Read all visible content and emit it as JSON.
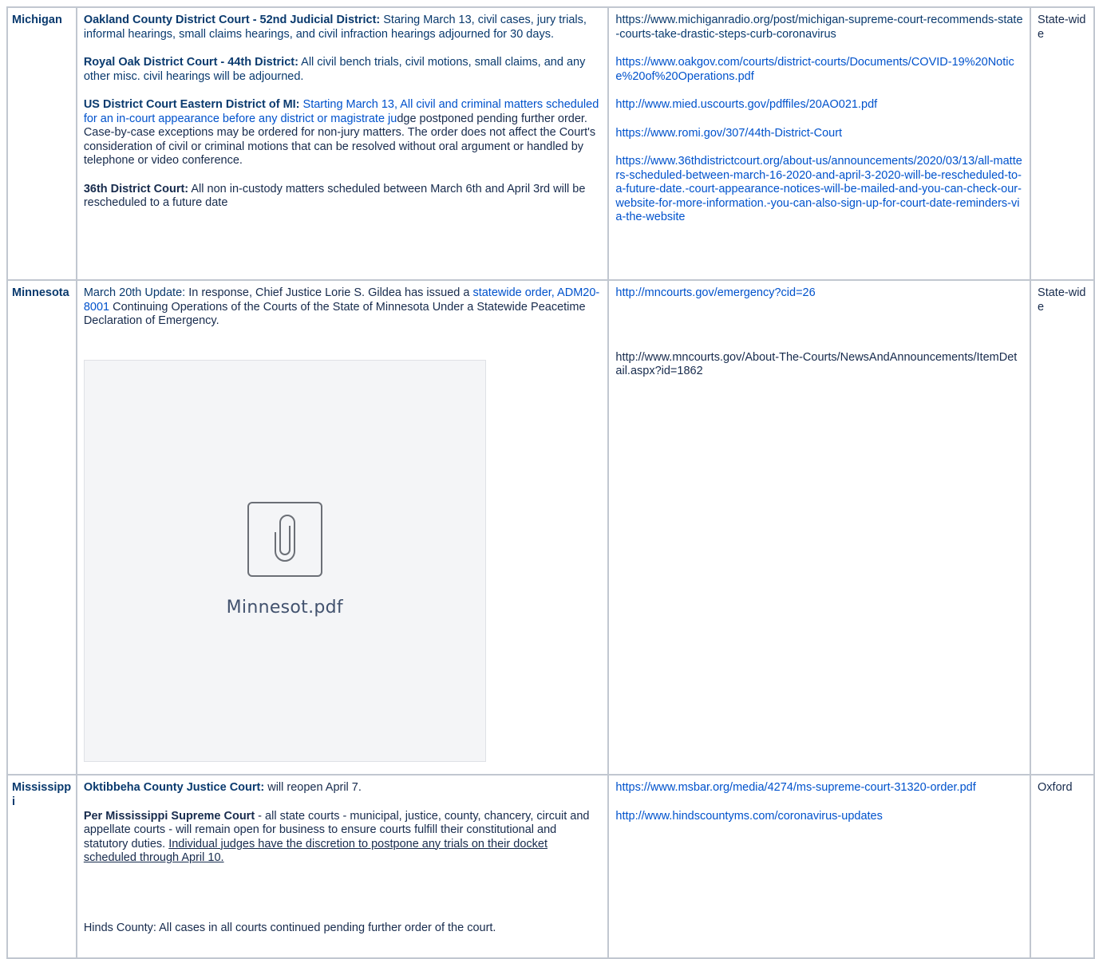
{
  "rows": [
    {
      "state": "Michigan",
      "scope": "State-wide",
      "paragraphs": [
        {
          "bold": "Oakland County District Court - 52nd Judicial District:",
          "text": " Staring March 13, civil cases, jury trials, informal hearings, small claims hearings, and civil infraction hearings adjourned for 30 days."
        },
        {
          "bold": "Royal Oak District Court - 44th District:",
          "text": " All civil bench trials, civil motions, small claims, and any other misc. civil hearings will be adjourned."
        },
        {
          "bold": "US District Court Eastern District of MI:",
          "text_link": "  Starting March 13, All civil and criminal matters scheduled for an in-court appearance before any district or magistrate ju",
          "text": "dge postponed pending further order.  Case-by-case exceptions may be ordered for non-jury matters.  The order does not affect the Court's consideration of civil or criminal motions that can be resolved without oral argument or handled by telephone or video conference."
        },
        {
          "bold": "36th District Court:",
          "text": " All non in-custody matters scheduled between March 6th and April 3rd will be rescheduled to a future date"
        }
      ],
      "links": [
        "https://www.michiganradio.org/post/michigan-supreme-court-recommends-state-courts-take-drastic-steps-curb-coronavirus",
        "https://www.oakgov.com/courts/district-courts/Documents/COVID-19%20Notice%20of%20Operations.pdf",
        "http://www.mied.uscourts.gov/pdffiles/20AO021.pdf",
        "https://www.romi.gov/307/44th-District-Court",
        "https://www.36thdistrictcourt.org/about-us/announcements/2020/03/13/all-matters-scheduled-between-march-16-2020-and-april-3-2020-will-be-rescheduled-to-a-future-date.-court-appearance-notices-will-be-mailed-and-you-can-check-our-website-for-more-information.-you-can-also-sign-up-for-court-date-reminders-via-the-website"
      ]
    },
    {
      "state": "Minnesota",
      "scope": "State-wide",
      "update_lead": "March 20th Update:",
      "update_text_1": "  In response, Chief Justice Lorie S. Gildea has issued a ",
      "update_link": "statewide order, ADM20-8001",
      "update_text_2": " Continuing Operations of the Courts of the State of Minnesota Under a Statewide Peacetime Declaration of Emergency.",
      "attachment": {
        "name": "Minnesot.pdf",
        "icon": "paperclip-icon"
      },
      "links": [
        "http://mncourts.gov/emergency?cid=26",
        "http://www.mncourts.gov/About-The-Courts/NewsAndAnnouncements/ItemDetail.aspx?id=1862"
      ]
    },
    {
      "state": "Mississippi",
      "scope": "Oxford",
      "p1_bold": "Oktibbeha County Justice Court:",
      "p1_text": " will reopen April 7.",
      "p2_bold": "Per Mississippi Supreme Court",
      "p2_text": " - all state courts - municipal, justice, county, chancery, circuit and appellate courts - will remain open for business to ensure courts fulfill their constitutional and statutory duties.  ",
      "p2_underline": "Individual judges have the discretion to postpone any trials on their docket scheduled through April 10.",
      "p3_text": "Hinds County: All cases in all courts continued pending further order of the court.",
      "links": [
        "https://www.msbar.org/media/4274/ms-supreme-court-31320-order.pdf",
        "http://www.hindscountyms.com/coronavirus-updates"
      ]
    }
  ],
  "colors": {
    "border": "#c1c7d0",
    "link": "#0052cc",
    "heading": "#0a3a6e",
    "text": "#172b4d"
  }
}
